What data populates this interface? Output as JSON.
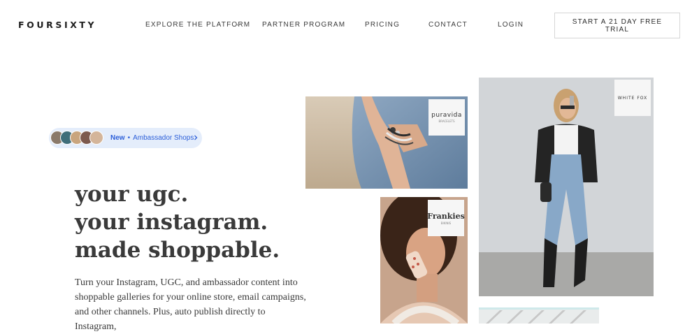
{
  "nav": {
    "logo": "FOURSIXTY",
    "links": {
      "explore": "EXPLORE THE PLATFORM",
      "partner": "PARTNER PROGRAM",
      "pricing": "PRICING",
      "contact": "CONTACT",
      "login": "LOGIN"
    },
    "cta": "START A 21 DAY FREE TRIAL"
  },
  "announcement": {
    "new_label": "New",
    "separator": "•",
    "text": "Ambassador Shops"
  },
  "hero": {
    "headline": [
      "your ugc.",
      "your instagram.",
      "made shoppable."
    ],
    "description": "Turn your Instagram, UGC, and ambassador content into shoppable galleries for your online store, email campaigns, and other channels. Plus, auto publish directly to Instagram,"
  },
  "gallery": {
    "brands": {
      "puravida": "puravida",
      "puravida_sub": "BRACELETS",
      "frankies": "Frankies",
      "frankies_sub": "BIKINIS",
      "whitefox": "WHITE FOX"
    }
  },
  "colors": {
    "accent_blue": "#2c5fd9",
    "pill_bg": "#e4edfb",
    "text_dark": "#3a3a3a"
  }
}
